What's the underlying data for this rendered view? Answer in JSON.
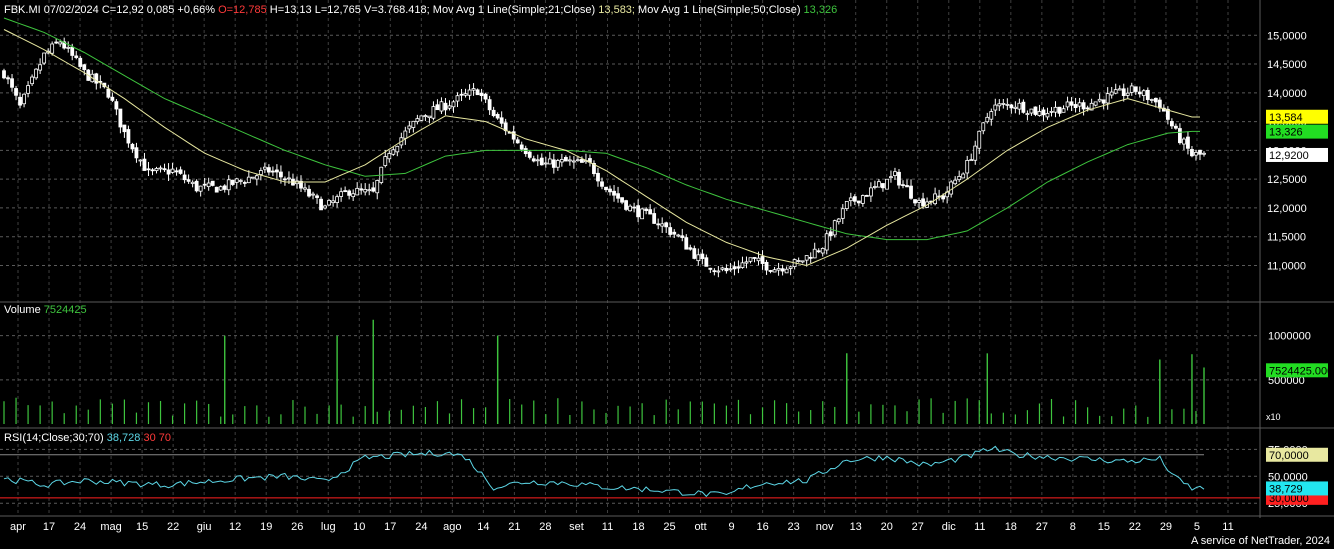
{
  "header": {
    "symbol": "FBK.MI",
    "date": "07/02/2024",
    "close_label": "C=12,92 0,085 +0,66%",
    "open_label": "O=12,785",
    "hlv_label": "H=13,13 L=12,765 V=3.768.418;",
    "ma21_label": "Mov Avg 1 Line(Simple;21;Close)",
    "ma21_value": "13,583;",
    "ma50_label": "Mov Avg 1 Line(Simple;50;Close)",
    "ma50_value": "13,326"
  },
  "volume_header": {
    "label": "Volume",
    "value": "7524425"
  },
  "rsi_header": {
    "label": "RSI(14;Close;30;70)",
    "value": "38,728",
    "low": "30",
    "high": "70"
  },
  "footer": "A service of NetTrader, 2024",
  "colors": {
    "background": "#000000",
    "grid": "#5a5a5a",
    "candle_up": "#ffffff",
    "candle_down": "#ffffff",
    "ma21": "#e8e8a0",
    "ma50": "#3ec43e",
    "volume": "#3ec43e",
    "rsi": "#5cd6e6",
    "rsi_bounds": "#ff2020",
    "ma21_tag_bg": "#ffff00",
    "ma50_tag_bg": "#22dd22",
    "close_tag_bg": "#ffffff",
    "rsi70_tag_bg": "#e8e8a0",
    "rsi_tag_bg": "#22e6f0",
    "rsi30_tag_bg": "#ff2020"
  },
  "chart_data": {
    "type": "candlestick",
    "price_axis": {
      "range": [
        10.4,
        15.3
      ],
      "ticks": [
        "15,0000",
        "14,5000",
        "14,0000",
        "13,5000",
        "13,0000",
        "12,5000",
        "12,0000",
        "11,5000",
        "11,0000"
      ],
      "tick_values": [
        15,
        14.5,
        14,
        13.5,
        13,
        12.5,
        12,
        11.5,
        11
      ]
    },
    "price_tags": {
      "ma21": "13,584",
      "ma50": "13,326",
      "close": "12,9200"
    },
    "volume_axis": {
      "range": [
        0,
        1200000
      ],
      "ticks": [
        "1000000",
        "500000"
      ],
      "tick_values": [
        1000000,
        500000
      ],
      "tag": "7524425.000",
      "small_tag": "x10"
    },
    "rsi_axis": {
      "range": [
        15,
        80
      ],
      "ticks": [
        "75,0000",
        "50,0000",
        "25,0000"
      ],
      "tick_values": [
        75,
        50,
        25
      ],
      "tags": {
        "high": "70,0000",
        "value": "38,729",
        "low": "30,0000"
      },
      "bounds": [
        30,
        70
      ]
    },
    "x_labels": [
      "apr",
      "17",
      "24",
      "mag",
      "15",
      "22",
      "giu",
      "12",
      "19",
      "26",
      "lug",
      "10",
      "17",
      "24",
      "ago",
      "14",
      "21",
      "28",
      "set",
      "11",
      "18",
      "25",
      "ott",
      "9",
      "16",
      "23",
      "nov",
      "13",
      "20",
      "27",
      "dic",
      "11",
      "18",
      "27",
      "8",
      "15",
      "22",
      "29",
      "5",
      "11"
    ],
    "close_anchors": [
      [
        0,
        14.35
      ],
      [
        4,
        13.75
      ],
      [
        10,
        14.65
      ],
      [
        14,
        14.9
      ],
      [
        20,
        14.35
      ],
      [
        26,
        14.0
      ],
      [
        30,
        13.3
      ],
      [
        36,
        12.6
      ],
      [
        42,
        12.65
      ],
      [
        48,
        12.35
      ],
      [
        54,
        12.35
      ],
      [
        60,
        12.5
      ],
      [
        66,
        12.65
      ],
      [
        72,
        12.45
      ],
      [
        80,
        12.0
      ],
      [
        86,
        12.3
      ],
      [
        92,
        12.25
      ],
      [
        96,
        13.0
      ],
      [
        104,
        13.6
      ],
      [
        112,
        13.85
      ],
      [
        118,
        14.05
      ],
      [
        122,
        13.6
      ],
      [
        128,
        13.15
      ],
      [
        134,
        12.75
      ],
      [
        140,
        12.8
      ],
      [
        146,
        12.75
      ],
      [
        150,
        12.35
      ],
      [
        156,
        12.0
      ],
      [
        162,
        11.8
      ],
      [
        168,
        11.5
      ],
      [
        174,
        11.05
      ],
      [
        180,
        10.9
      ],
      [
        186,
        11.1
      ],
      [
        192,
        10.95
      ],
      [
        198,
        11.05
      ],
      [
        204,
        11.35
      ],
      [
        210,
        12.05
      ],
      [
        216,
        12.3
      ],
      [
        222,
        12.55
      ],
      [
        228,
        12.1
      ],
      [
        234,
        12.2
      ],
      [
        240,
        12.75
      ],
      [
        246,
        13.75
      ],
      [
        252,
        13.8
      ],
      [
        258,
        13.65
      ],
      [
        264,
        13.75
      ],
      [
        270,
        13.8
      ],
      [
        276,
        13.95
      ],
      [
        282,
        14.05
      ],
      [
        288,
        13.8
      ],
      [
        292,
        13.3
      ],
      [
        296,
        12.92
      ]
    ],
    "ma21_anchors": [
      [
        0,
        15.1
      ],
      [
        10,
        14.75
      ],
      [
        20,
        14.35
      ],
      [
        30,
        13.9
      ],
      [
        40,
        13.4
      ],
      [
        50,
        12.95
      ],
      [
        60,
        12.65
      ],
      [
        70,
        12.45
      ],
      [
        80,
        12.45
      ],
      [
        90,
        12.75
      ],
      [
        100,
        13.2
      ],
      [
        110,
        13.6
      ],
      [
        120,
        13.5
      ],
      [
        130,
        13.2
      ],
      [
        140,
        13.0
      ],
      [
        150,
        12.65
      ],
      [
        160,
        12.2
      ],
      [
        170,
        11.75
      ],
      [
        180,
        11.4
      ],
      [
        190,
        11.15
      ],
      [
        200,
        11.0
      ],
      [
        210,
        11.3
      ],
      [
        220,
        11.7
      ],
      [
        230,
        12.05
      ],
      [
        240,
        12.5
      ],
      [
        250,
        13.0
      ],
      [
        260,
        13.4
      ],
      [
        270,
        13.7
      ],
      [
        280,
        13.9
      ],
      [
        290,
        13.7
      ],
      [
        296,
        13.58
      ]
    ],
    "ma50_anchors": [
      [
        0,
        15.3
      ],
      [
        10,
        15.05
      ],
      [
        20,
        14.7
      ],
      [
        30,
        14.3
      ],
      [
        40,
        13.9
      ],
      [
        50,
        13.6
      ],
      [
        60,
        13.3
      ],
      [
        70,
        13.0
      ],
      [
        80,
        12.75
      ],
      [
        90,
        12.55
      ],
      [
        100,
        12.6
      ],
      [
        110,
        12.9
      ],
      [
        120,
        13.0
      ],
      [
        130,
        13.0
      ],
      [
        140,
        13.0
      ],
      [
        150,
        12.95
      ],
      [
        160,
        12.7
      ],
      [
        170,
        12.4
      ],
      [
        180,
        12.15
      ],
      [
        190,
        11.95
      ],
      [
        200,
        11.75
      ],
      [
        210,
        11.55
      ],
      [
        220,
        11.45
      ],
      [
        230,
        11.45
      ],
      [
        240,
        11.6
      ],
      [
        250,
        12.0
      ],
      [
        260,
        12.45
      ],
      [
        270,
        12.8
      ],
      [
        280,
        13.1
      ],
      [
        290,
        13.3
      ],
      [
        296,
        13.33
      ]
    ],
    "volume_spikes": [
      [
        55,
        1000000
      ],
      [
        83,
        1000000
      ],
      [
        92,
        1180000
      ],
      [
        123,
        1000000
      ],
      [
        210,
        800000
      ],
      [
        245,
        800000
      ],
      [
        288,
        730000
      ],
      [
        296,
        790000
      ],
      [
        299,
        640000
      ]
    ],
    "rsi_anchors": [
      [
        0,
        48
      ],
      [
        10,
        42
      ],
      [
        20,
        46
      ],
      [
        30,
        44
      ],
      [
        40,
        42
      ],
      [
        50,
        45
      ],
      [
        60,
        48
      ],
      [
        70,
        50
      ],
      [
        80,
        45
      ],
      [
        90,
        67
      ],
      [
        100,
        70
      ],
      [
        110,
        72
      ],
      [
        115,
        68
      ],
      [
        122,
        40
      ],
      [
        130,
        45
      ],
      [
        140,
        44
      ],
      [
        150,
        40
      ],
      [
        160,
        38
      ],
      [
        170,
        35
      ],
      [
        180,
        32
      ],
      [
        185,
        40
      ],
      [
        190,
        44
      ],
      [
        200,
        46
      ],
      [
        210,
        65
      ],
      [
        220,
        68
      ],
      [
        230,
        60
      ],
      [
        240,
        68
      ],
      [
        246,
        76
      ],
      [
        252,
        70
      ],
      [
        260,
        68
      ],
      [
        270,
        66
      ],
      [
        280,
        64
      ],
      [
        288,
        66
      ],
      [
        292,
        48
      ],
      [
        296,
        38.73
      ]
    ],
    "bars": 300
  }
}
